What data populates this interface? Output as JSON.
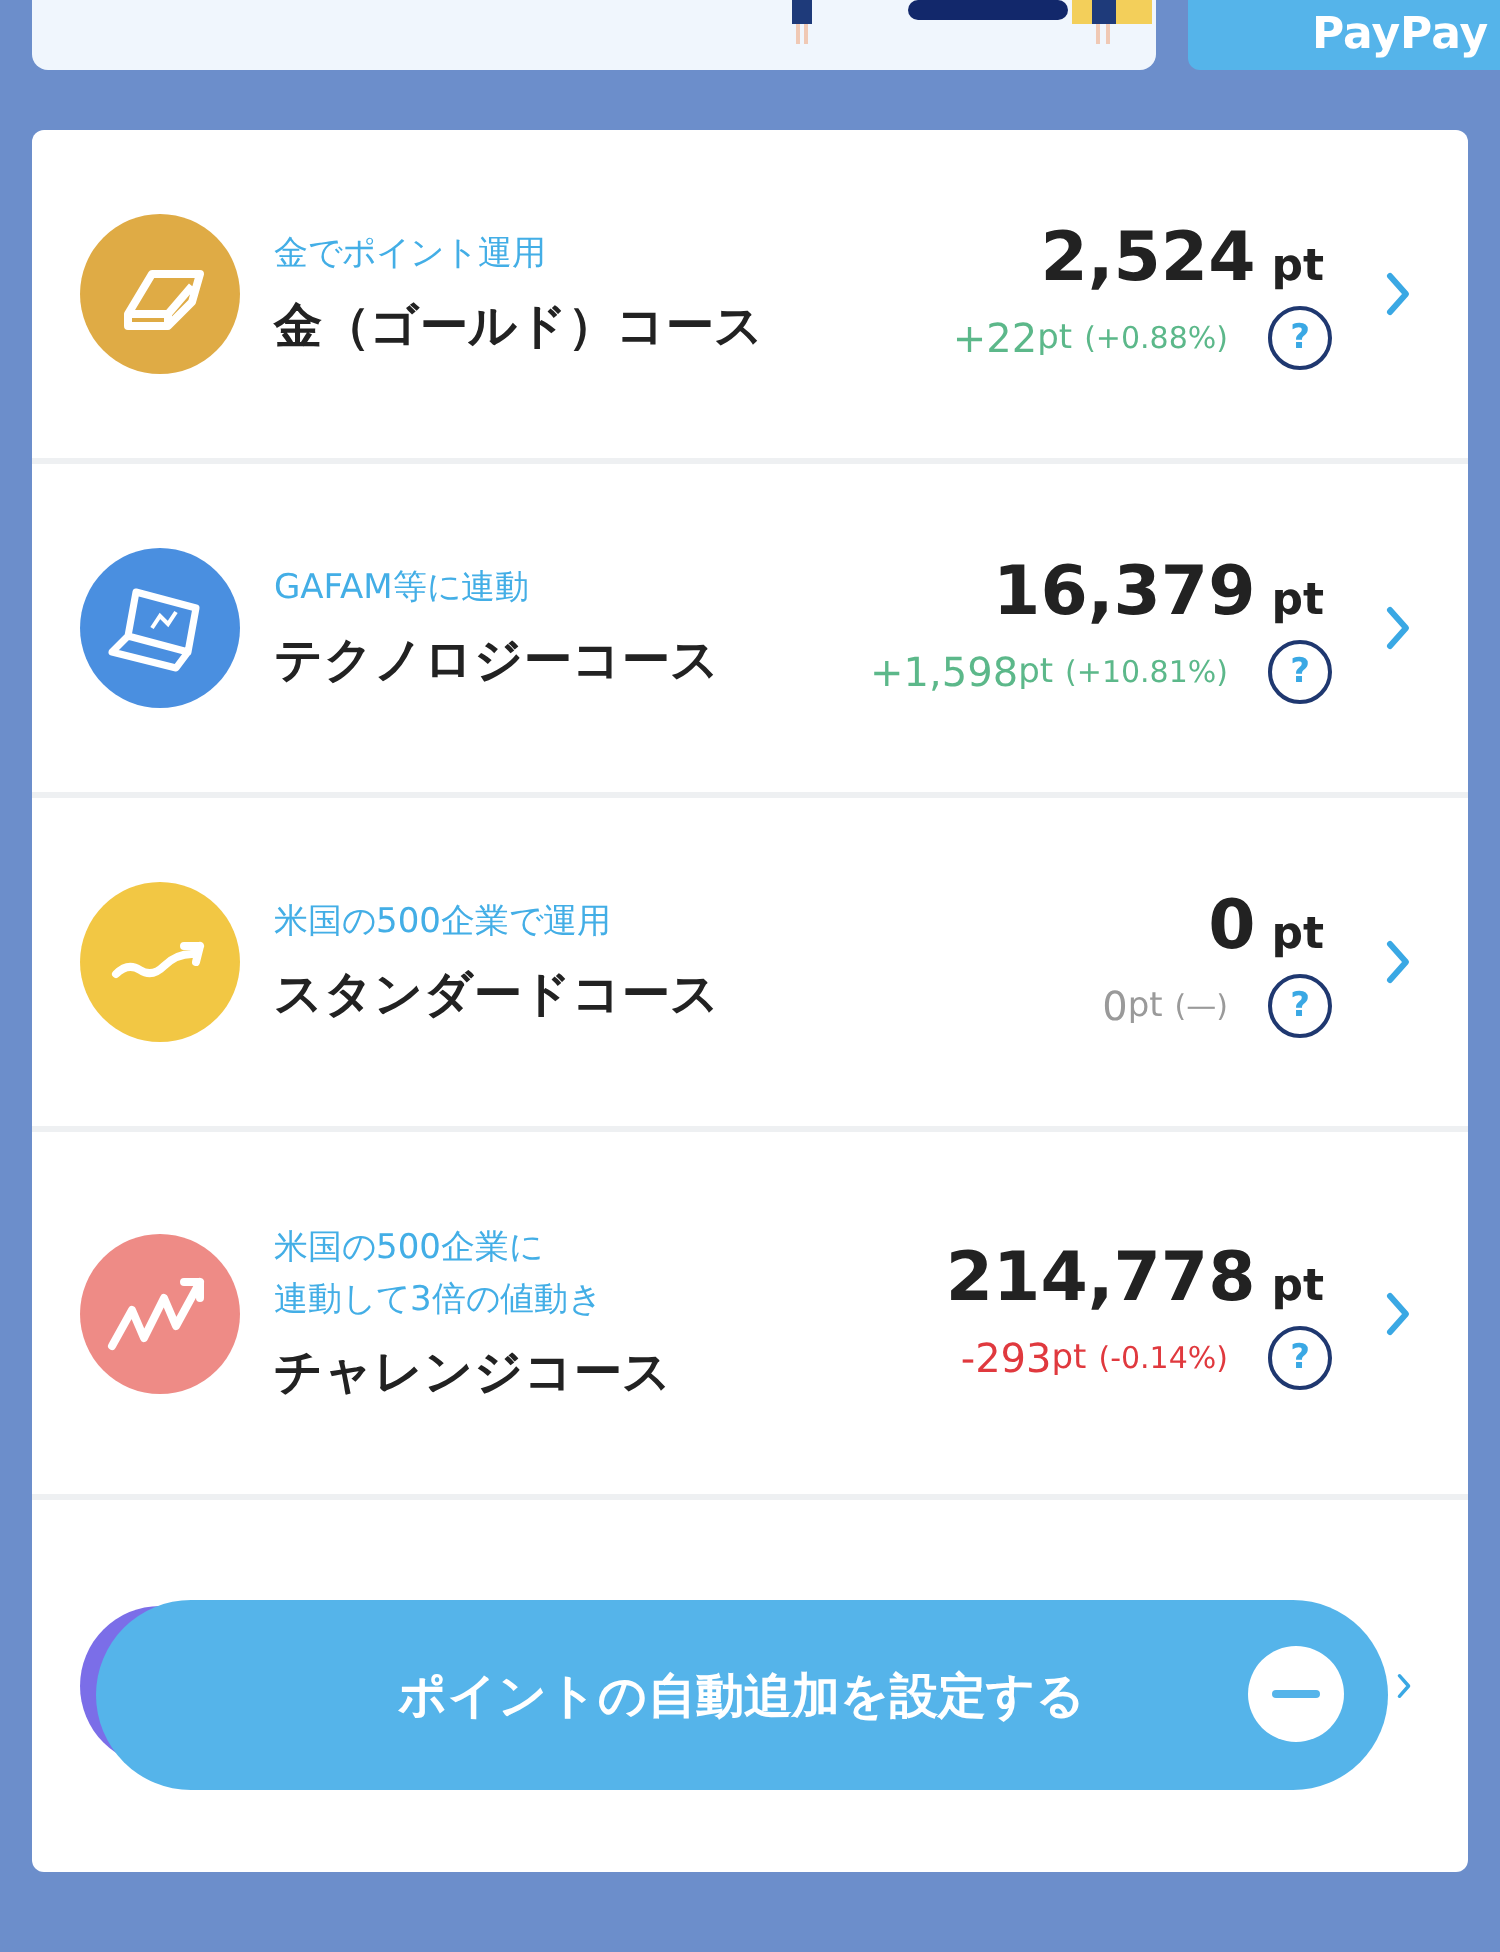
{
  "top_button": {
    "label": "PayPay"
  },
  "courses": [
    {
      "kind": "gold",
      "color": "#dfab45",
      "subtitle": [
        "金でポイント運用"
      ],
      "title": "金（ゴールド）コース",
      "value": "2,524",
      "unit": "pt",
      "change": {
        "amount": "+22",
        "unit": "pt",
        "percent": "(+0.88%)",
        "color": "#5cb88a"
      },
      "help": "?"
    },
    {
      "kind": "tech",
      "color": "#4a8fe0",
      "subtitle": [
        "GAFAM等に連動"
      ],
      "title": "テクノロジーコース",
      "value": "16,379",
      "unit": "pt",
      "change": {
        "amount": "+1,598",
        "unit": "pt",
        "percent": "(+10.81%)",
        "color": "#5cb88a"
      },
      "help": "?"
    },
    {
      "kind": "standard",
      "color": "#f2c744",
      "subtitle": [
        "米国の500企業で運用"
      ],
      "title": "スタンダードコース",
      "value": "0",
      "unit": "pt",
      "change": {
        "amount": "0",
        "unit": "pt",
        "percent": "(—)",
        "color": "#9a9a9a"
      },
      "help": "?"
    },
    {
      "kind": "challenge",
      "color": "#ee8b86",
      "subtitle": [
        "米国の500企業に",
        "連動して3倍の値動き"
      ],
      "title": "チャレンジコース",
      "value": "214,778",
      "unit": "pt",
      "change": {
        "amount": "-293",
        "unit": "pt",
        "percent": "(-0.14%)",
        "color": "#e0393e"
      },
      "help": "?"
    },
    {
      "kind": "covered",
      "color": "#7b6ee8"
    }
  ],
  "auto_add_button": {
    "label": "ポイントの自動追加を設定する"
  }
}
